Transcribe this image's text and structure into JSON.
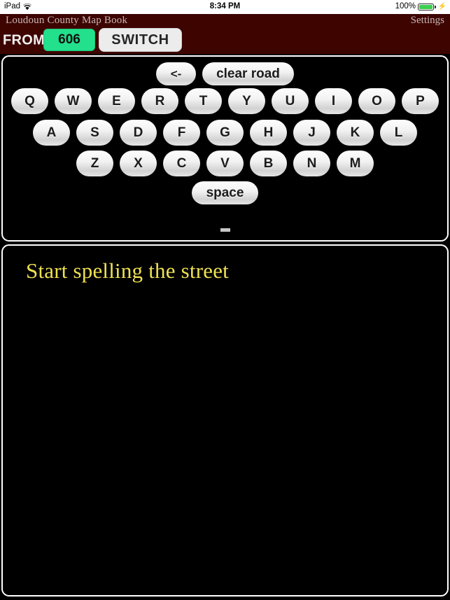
{
  "status_bar": {
    "device": "iPad",
    "wifi_icon": "wifi-icon",
    "time": "8:34 PM",
    "battery_percent": "100%",
    "battery_icon": "battery-icon",
    "charging_icon": "lightning-bolt-icon"
  },
  "header": {
    "app_title": "Loudoun County Map Book",
    "settings_label": "Settings",
    "from_label": "FROM",
    "road_value": "606",
    "switch_label": "SWITCH",
    "colors": {
      "header_background": "#3D0400",
      "road_button": "#22E08C",
      "switch_button": "#ECECEC",
      "title_text": "#C9B8B6"
    }
  },
  "keyboard": {
    "backspace_label": "<-",
    "clear_label": "clear road",
    "space_label": "space",
    "rows": [
      [
        "Q",
        "W",
        "E",
        "R",
        "T",
        "Y",
        "U",
        "I",
        "O",
        "P"
      ],
      [
        "A",
        "S",
        "D",
        "F",
        "G",
        "H",
        "J",
        "K",
        "L"
      ],
      [
        "Z",
        "X",
        "C",
        "V",
        "B",
        "N",
        "M"
      ]
    ],
    "caret": "text-caret"
  },
  "text_panel": {
    "prompt": "Start spelling the street",
    "prompt_color": "#EEE152",
    "background": "#000000"
  }
}
